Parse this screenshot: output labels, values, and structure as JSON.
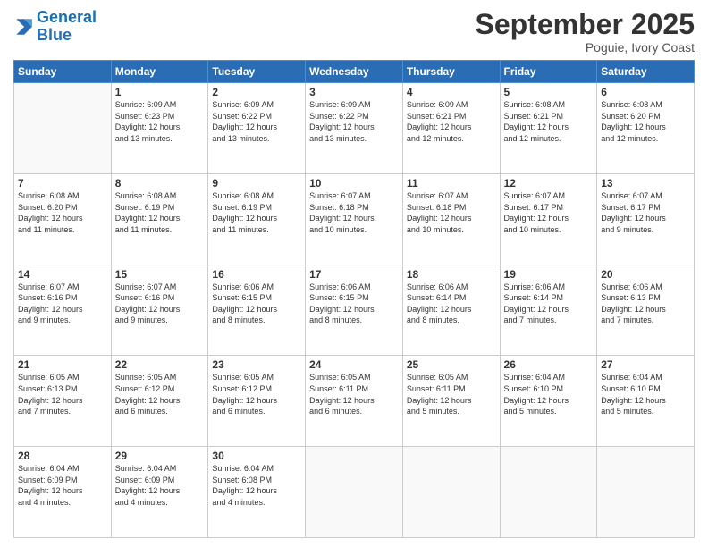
{
  "logo": {
    "line1": "General",
    "line2": "Blue"
  },
  "title": "September 2025",
  "location": "Poguie, Ivory Coast",
  "days_of_week": [
    "Sunday",
    "Monday",
    "Tuesday",
    "Wednesday",
    "Thursday",
    "Friday",
    "Saturday"
  ],
  "weeks": [
    [
      {
        "day": "",
        "info": ""
      },
      {
        "day": "1",
        "info": "Sunrise: 6:09 AM\nSunset: 6:23 PM\nDaylight: 12 hours\nand 13 minutes."
      },
      {
        "day": "2",
        "info": "Sunrise: 6:09 AM\nSunset: 6:22 PM\nDaylight: 12 hours\nand 13 minutes."
      },
      {
        "day": "3",
        "info": "Sunrise: 6:09 AM\nSunset: 6:22 PM\nDaylight: 12 hours\nand 13 minutes."
      },
      {
        "day": "4",
        "info": "Sunrise: 6:09 AM\nSunset: 6:21 PM\nDaylight: 12 hours\nand 12 minutes."
      },
      {
        "day": "5",
        "info": "Sunrise: 6:08 AM\nSunset: 6:21 PM\nDaylight: 12 hours\nand 12 minutes."
      },
      {
        "day": "6",
        "info": "Sunrise: 6:08 AM\nSunset: 6:20 PM\nDaylight: 12 hours\nand 12 minutes."
      }
    ],
    [
      {
        "day": "7",
        "info": "Sunrise: 6:08 AM\nSunset: 6:20 PM\nDaylight: 12 hours\nand 11 minutes."
      },
      {
        "day": "8",
        "info": "Sunrise: 6:08 AM\nSunset: 6:19 PM\nDaylight: 12 hours\nand 11 minutes."
      },
      {
        "day": "9",
        "info": "Sunrise: 6:08 AM\nSunset: 6:19 PM\nDaylight: 12 hours\nand 11 minutes."
      },
      {
        "day": "10",
        "info": "Sunrise: 6:07 AM\nSunset: 6:18 PM\nDaylight: 12 hours\nand 10 minutes."
      },
      {
        "day": "11",
        "info": "Sunrise: 6:07 AM\nSunset: 6:18 PM\nDaylight: 12 hours\nand 10 minutes."
      },
      {
        "day": "12",
        "info": "Sunrise: 6:07 AM\nSunset: 6:17 PM\nDaylight: 12 hours\nand 10 minutes."
      },
      {
        "day": "13",
        "info": "Sunrise: 6:07 AM\nSunset: 6:17 PM\nDaylight: 12 hours\nand 9 minutes."
      }
    ],
    [
      {
        "day": "14",
        "info": "Sunrise: 6:07 AM\nSunset: 6:16 PM\nDaylight: 12 hours\nand 9 minutes."
      },
      {
        "day": "15",
        "info": "Sunrise: 6:07 AM\nSunset: 6:16 PM\nDaylight: 12 hours\nand 9 minutes."
      },
      {
        "day": "16",
        "info": "Sunrise: 6:06 AM\nSunset: 6:15 PM\nDaylight: 12 hours\nand 8 minutes."
      },
      {
        "day": "17",
        "info": "Sunrise: 6:06 AM\nSunset: 6:15 PM\nDaylight: 12 hours\nand 8 minutes."
      },
      {
        "day": "18",
        "info": "Sunrise: 6:06 AM\nSunset: 6:14 PM\nDaylight: 12 hours\nand 8 minutes."
      },
      {
        "day": "19",
        "info": "Sunrise: 6:06 AM\nSunset: 6:14 PM\nDaylight: 12 hours\nand 7 minutes."
      },
      {
        "day": "20",
        "info": "Sunrise: 6:06 AM\nSunset: 6:13 PM\nDaylight: 12 hours\nand 7 minutes."
      }
    ],
    [
      {
        "day": "21",
        "info": "Sunrise: 6:05 AM\nSunset: 6:13 PM\nDaylight: 12 hours\nand 7 minutes."
      },
      {
        "day": "22",
        "info": "Sunrise: 6:05 AM\nSunset: 6:12 PM\nDaylight: 12 hours\nand 6 minutes."
      },
      {
        "day": "23",
        "info": "Sunrise: 6:05 AM\nSunset: 6:12 PM\nDaylight: 12 hours\nand 6 minutes."
      },
      {
        "day": "24",
        "info": "Sunrise: 6:05 AM\nSunset: 6:11 PM\nDaylight: 12 hours\nand 6 minutes."
      },
      {
        "day": "25",
        "info": "Sunrise: 6:05 AM\nSunset: 6:11 PM\nDaylight: 12 hours\nand 5 minutes."
      },
      {
        "day": "26",
        "info": "Sunrise: 6:04 AM\nSunset: 6:10 PM\nDaylight: 12 hours\nand 5 minutes."
      },
      {
        "day": "27",
        "info": "Sunrise: 6:04 AM\nSunset: 6:10 PM\nDaylight: 12 hours\nand 5 minutes."
      }
    ],
    [
      {
        "day": "28",
        "info": "Sunrise: 6:04 AM\nSunset: 6:09 PM\nDaylight: 12 hours\nand 4 minutes."
      },
      {
        "day": "29",
        "info": "Sunrise: 6:04 AM\nSunset: 6:09 PM\nDaylight: 12 hours\nand 4 minutes."
      },
      {
        "day": "30",
        "info": "Sunrise: 6:04 AM\nSunset: 6:08 PM\nDaylight: 12 hours\nand 4 minutes."
      },
      {
        "day": "",
        "info": ""
      },
      {
        "day": "",
        "info": ""
      },
      {
        "day": "",
        "info": ""
      },
      {
        "day": "",
        "info": ""
      }
    ]
  ]
}
